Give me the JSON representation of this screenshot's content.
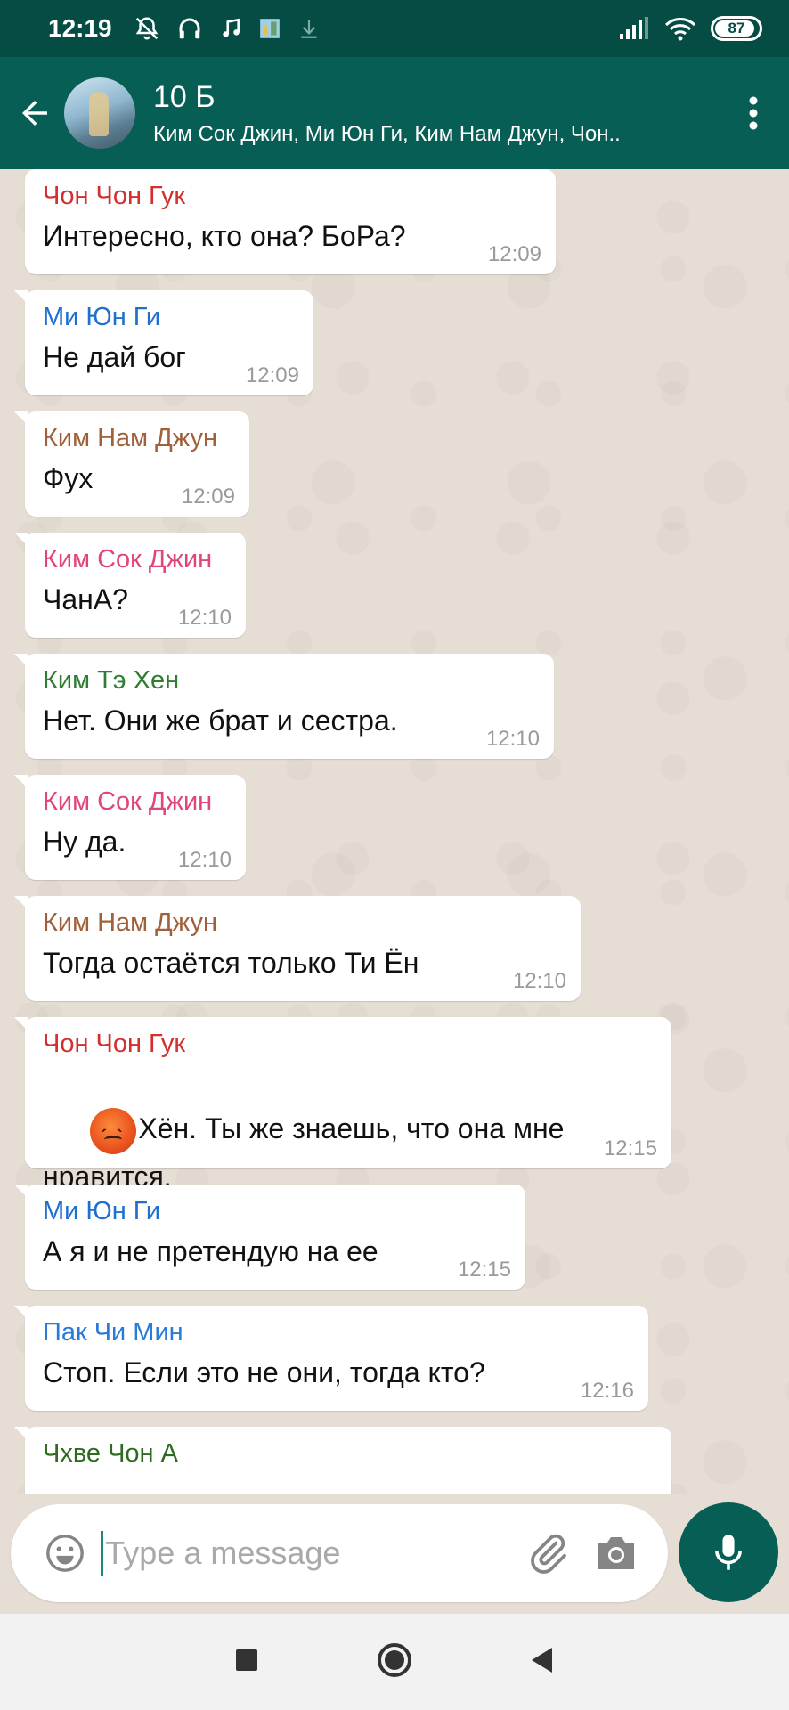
{
  "status_bar": {
    "time": "12:19",
    "battery": "87"
  },
  "header": {
    "title": "10 Б",
    "members": "Ким Сок Джин, Ми Юн Ги, Ким Нам Джун, Чон.."
  },
  "colors": {
    "header": "#075e54",
    "status_bar": "#054d44",
    "chat_background": "#e6ddd4",
    "accent": "#1a8a7c"
  },
  "messages": [
    {
      "sender": "Чон Чон Гук",
      "sender_color": "#d32f2f",
      "text": "Интересно, кто она? БоРа?",
      "time": "12:09"
    },
    {
      "sender": "Ми Юн Ги",
      "sender_color": "#1e6fd0",
      "text": "Не дай бог",
      "time": "12:09"
    },
    {
      "sender": "Ким Нам Джун",
      "sender_color": "#a0603a",
      "text": "Фух",
      "time": "12:09"
    },
    {
      "sender": "Ким Сок Джин",
      "sender_color": "#e0457b",
      "text": "ЧанА?",
      "time": "12:10"
    },
    {
      "sender": "Ким Тэ Хен",
      "sender_color": "#2e7d32",
      "text": "Нет. Они же брат и сестра.",
      "time": "12:10"
    },
    {
      "sender": "Ким Сок Джин",
      "sender_color": "#e0457b",
      "text": "Ну да.",
      "time": "12:10"
    },
    {
      "sender": "Ким Нам Джун",
      "sender_color": "#a0603a",
      "text": "Тогда остаётся только Ти Ён",
      "time": "12:10"
    },
    {
      "sender": "Чон Чон Гук",
      "sender_color": "#d32f2f",
      "emoji": "angry-face",
      "text": "Хён. Ты же знаешь, что она мне нравится.",
      "time": "12:15"
    },
    {
      "sender": "Ми Юн Ги",
      "sender_color": "#1e6fd0",
      "text": "А я и не претендую на ее",
      "time": "12:15"
    },
    {
      "sender": "Пак Чи Мин",
      "sender_color": "#2a7bd6",
      "text": "Стоп. Если это не они, тогда кто?",
      "time": "12:16"
    },
    {
      "sender": "Чхве Чон А",
      "sender_color": "#2e6b1f",
      "text": "",
      "time": ""
    }
  ],
  "input": {
    "placeholder": "Type a message"
  }
}
